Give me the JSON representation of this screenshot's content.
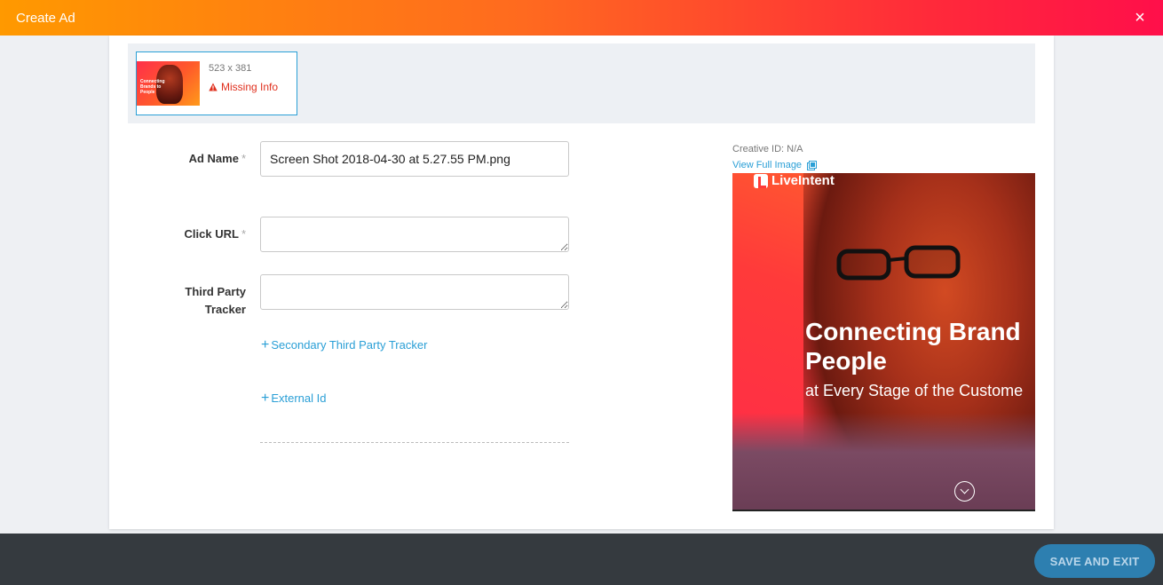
{
  "header": {
    "title": "Create Ad",
    "close_label": "×"
  },
  "thumbnail": {
    "size": "523 x 381",
    "status": "Missing Info",
    "image_text": "Connecting Brands to People"
  },
  "form": {
    "ad_name": {
      "label": "Ad Name",
      "required": "*",
      "value": "Screen Shot 2018-04-30 at 5.27.55 PM.png"
    },
    "click_url": {
      "label": "Click URL",
      "required": "*",
      "value": ""
    },
    "third_party_tracker": {
      "label_line1": "Third Party",
      "label_line2": "Tracker",
      "value": ""
    },
    "secondary_tracker_link": "Secondary Third Party Tracker",
    "external_id_link": "External Id",
    "plus": "+"
  },
  "preview": {
    "creative_id": "Creative ID: N/A",
    "view_full_image": "View Full Image",
    "logo_text": "LiveIntent",
    "headline_line1": "Connecting Brand",
    "headline_line2": "People",
    "subheadline": "at Every Stage of the Custome"
  },
  "footer": {
    "save_exit": "SAVE AND EXIT"
  },
  "colors": {
    "accent": "#2a9fd6",
    "warning": "#e0301e",
    "footer_bg": "#353a3f",
    "save_btn": "#2d7fb0"
  },
  "icons": {
    "close": "close-icon",
    "warning": "warning-icon",
    "external_link": "external-link-icon",
    "plus": "plus-icon",
    "chevron_down": "chevron-down-icon"
  }
}
